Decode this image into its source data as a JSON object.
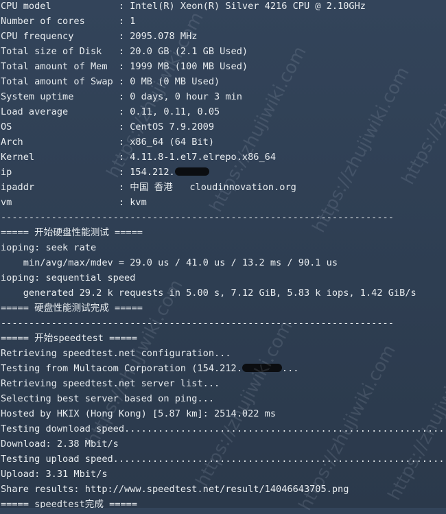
{
  "watermark": "https://zhujiwiki.com",
  "lines": [
    "CPU model            : Intel(R) Xeon(R) Silver 4216 CPU @ 2.10GHz",
    "Number of cores      : 1",
    "CPU frequency        : 2095.078 MHz",
    "Total size of Disk   : 20.0 GB (2.1 GB Used)",
    "Total amount of Mem  : 1999 MB (100 MB Used)",
    "Total amount of Swap : 0 MB (0 MB Used)",
    "System uptime        : 0 days, 0 hour 3 min",
    "Load average         : 0.11, 0.11, 0.05",
    "OS                   : CentOS 7.9.2009",
    "Arch                 : x86_64 (64 Bit)",
    "Kernel               : 4.11.8-1.el7.elrepo.x86_64",
    "ip                   : 154.212.",
    "ipaddr               : 中国 香港   cloudinnovation.org",
    "vm                   : kvm",
    "----------------------------------------------------------------------",
    "===== 开始硬盘性能测试 =====",
    "ioping: seek rate",
    "    min/avg/max/mdev = 29.0 us / 41.0 us / 13.2 ms / 90.1 us",
    "ioping: sequential speed",
    "    generated 29.2 k requests in 5.00 s, 7.12 GiB, 5.83 k iops, 1.42 GiB/s",
    "===== 硬盘性能测试完成 =====",
    "----------------------------------------------------------------------",
    "===== 开始speedtest =====",
    "Retrieving speedtest.net configuration...",
    "Testing from Multacom Corporation (154.212.",
    "Retrieving speedtest.net server list...",
    "Selecting best server based on ping...",
    "Hosted by HKIX (Hong Kong) [5.87 km]: 2514.022 ms",
    "Testing download speed................................................................................",
    "Download: 2.38 Mbit/s",
    "Testing upload speed................................................................................",
    "Upload: 3.31 Mbit/s",
    "Share results: http://www.speedtest.net/result/14046643705.png",
    "===== speedtest完成 ====="
  ],
  "line24_suffix": "...",
  "redaction_color": "#0b0d10"
}
